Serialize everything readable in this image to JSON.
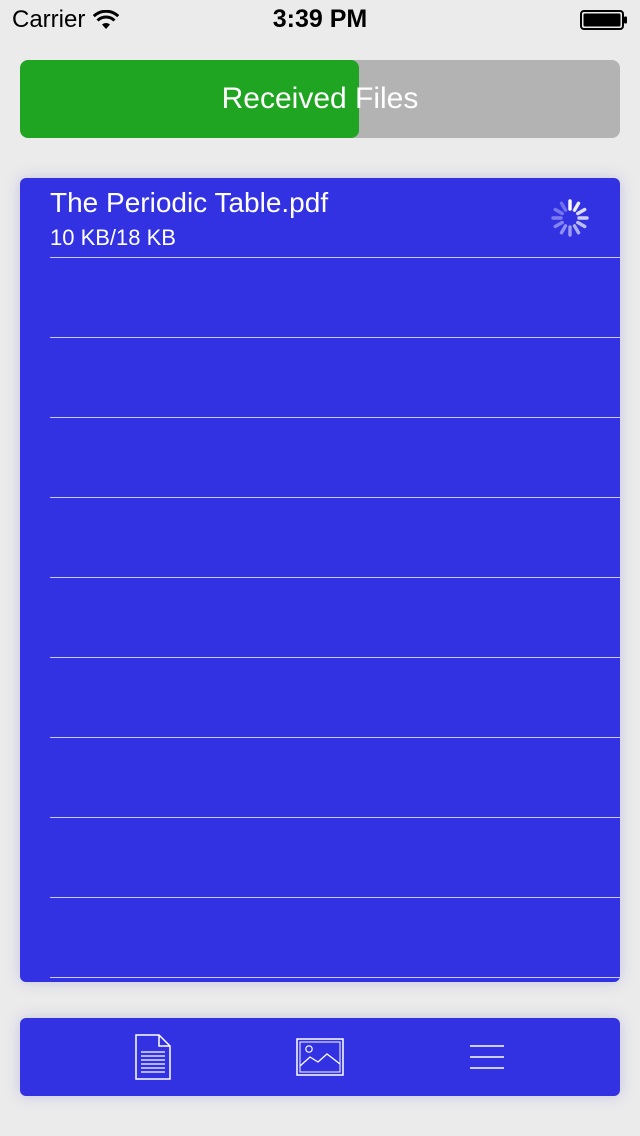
{
  "status_bar": {
    "carrier": "Carrier",
    "time": "3:39 PM"
  },
  "header": {
    "title": "Received Files",
    "progress": 0.565,
    "fill_color": "#1fa522",
    "track_color": "#b3b3b3"
  },
  "files": [
    {
      "name": "The Periodic Table.pdf",
      "size": "10 KB/18 KB",
      "status_icon": "spinner-icon"
    }
  ],
  "panel_color": "#3232e3",
  "toolbar": {
    "items": [
      {
        "icon": "document-icon"
      },
      {
        "icon": "image-icon"
      },
      {
        "icon": "menu-icon"
      }
    ]
  }
}
